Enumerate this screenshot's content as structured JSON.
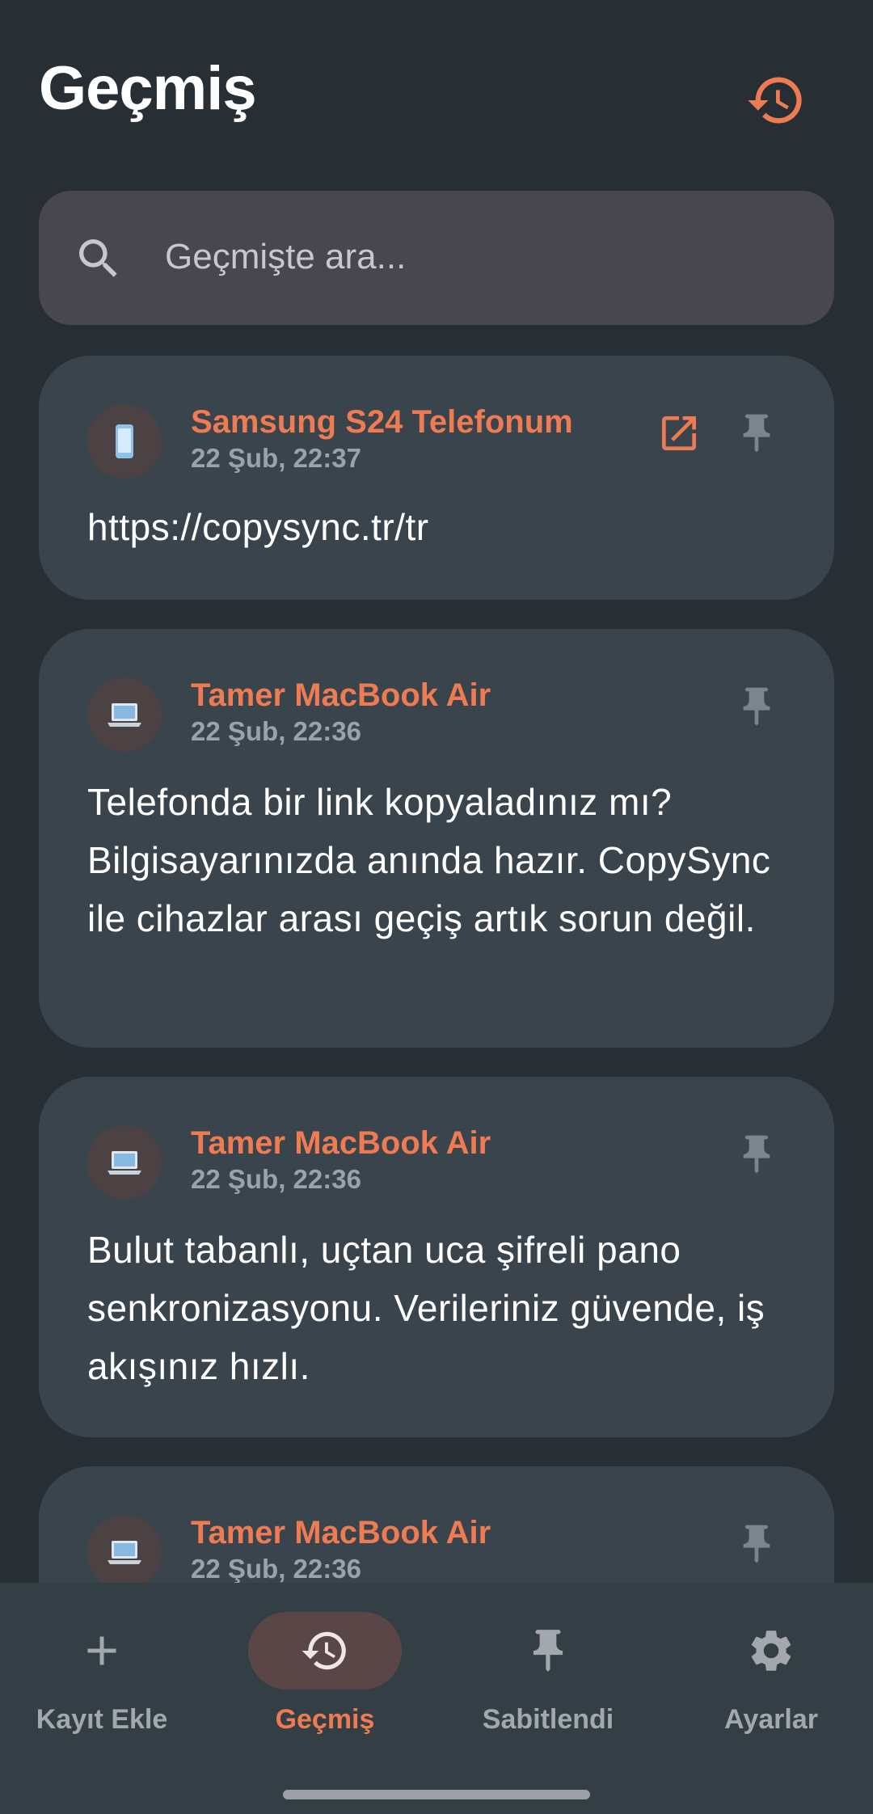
{
  "header": {
    "title": "Geçmiş",
    "action_icon": "history-icon"
  },
  "search": {
    "placeholder": "Geçmişte ara...",
    "value": ""
  },
  "colors": {
    "accent": "#ee7b52",
    "background": "#272e34",
    "card": "#39444c",
    "nav": "#343e45"
  },
  "entries": [
    {
      "device": "Samsung S24 Telefonum",
      "device_icon": "phone-icon",
      "time": "22 Şub, 22:37",
      "text": "https://copysync.tr/tr",
      "has_open_link": true,
      "pin_icon": "pin-icon"
    },
    {
      "device": "Tamer MacBook Air",
      "device_icon": "laptop-icon",
      "time": "22 Şub, 22:36",
      "text": "Telefonda bir link kopyaladınız mı? Bilgisayarınızda anında hazır. CopySync ile cihazlar arası geçiş artık sorun değil.",
      "has_open_link": false,
      "pin_icon": "pin-icon"
    },
    {
      "device": "Tamer MacBook Air",
      "device_icon": "laptop-icon",
      "time": "22 Şub, 22:36",
      "text": "Bulut tabanlı, uçtan uca şifreli pano senkronizasyonu. Verileriniz güvende, iş akışınız hızlı.",
      "has_open_link": false,
      "pin_icon": "pin-icon"
    },
    {
      "device": "Tamer MacBook Air",
      "device_icon": "laptop-icon",
      "time": "22 Şub, 22:36",
      "text": "",
      "has_open_link": false,
      "pin_icon": "pin-icon"
    }
  ],
  "nav": [
    {
      "label": "Kayıt Ekle",
      "icon": "plus-icon",
      "active": false
    },
    {
      "label": "Geçmiş",
      "icon": "history-icon",
      "active": true
    },
    {
      "label": "Sabitlendi",
      "icon": "pin-icon",
      "active": false
    },
    {
      "label": "Ayarlar",
      "icon": "gear-icon",
      "active": false
    }
  ]
}
